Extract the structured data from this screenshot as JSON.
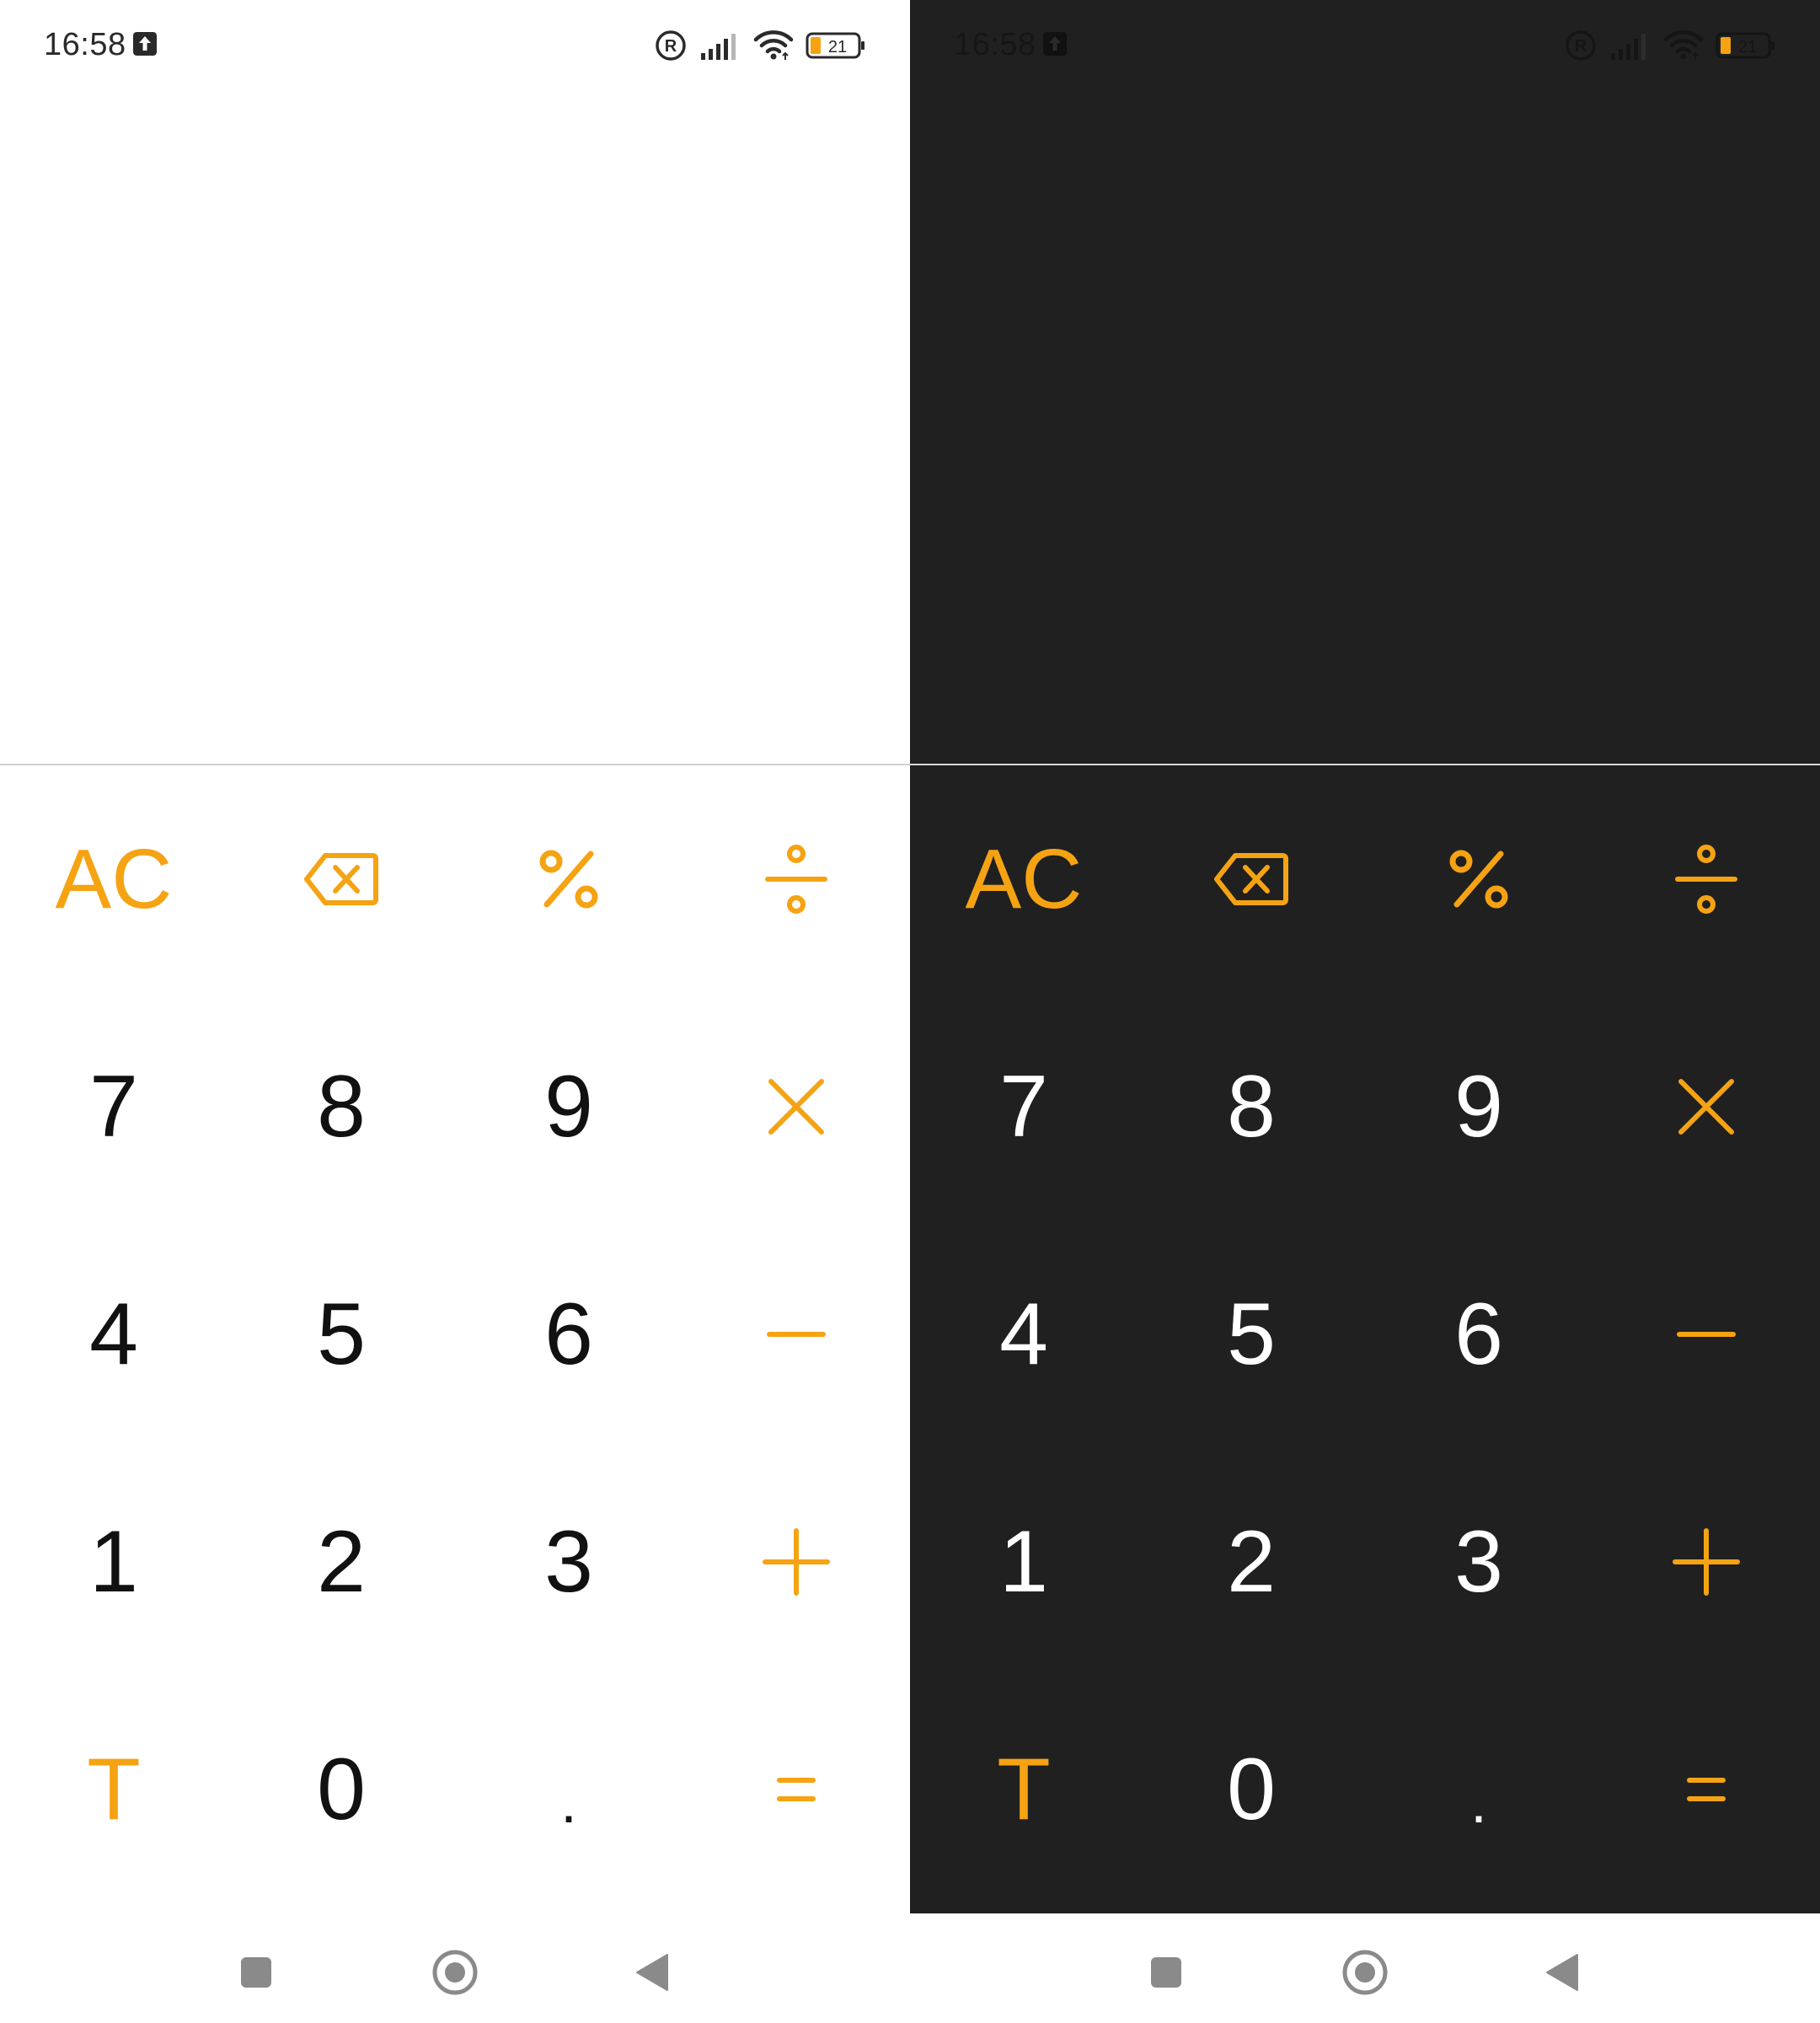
{
  "status_bar": {
    "time": "16:58",
    "battery_level": "21"
  },
  "keypad": {
    "row1": {
      "clear": "AC",
      "backspace_icon": "backspace-icon",
      "percent_icon": "percent-icon",
      "divide_icon": "divide-icon"
    },
    "row2": {
      "k7": "7",
      "k8": "8",
      "k9": "9",
      "multiply_icon": "multiply-icon"
    },
    "row3": {
      "k4": "4",
      "k5": "5",
      "k6": "6",
      "minus_icon": "minus-icon"
    },
    "row4": {
      "k1": "1",
      "k2": "2",
      "k3": "3",
      "plus_icon": "plus-icon"
    },
    "row5": {
      "toggle": "T",
      "k0": "0",
      "decimal": ".",
      "equals_icon": "equals-icon"
    }
  },
  "themes": {
    "light": {
      "background": "#ffffff",
      "digit_color": "#111111",
      "accent": "#f5a313"
    },
    "dark": {
      "background": "#202020",
      "digit_color": "#ffffff",
      "accent": "#f5a313"
    }
  },
  "nav_bar": {
    "icons": [
      "recents-square-icon",
      "home-circle-icon",
      "back-triangle-icon"
    ]
  }
}
